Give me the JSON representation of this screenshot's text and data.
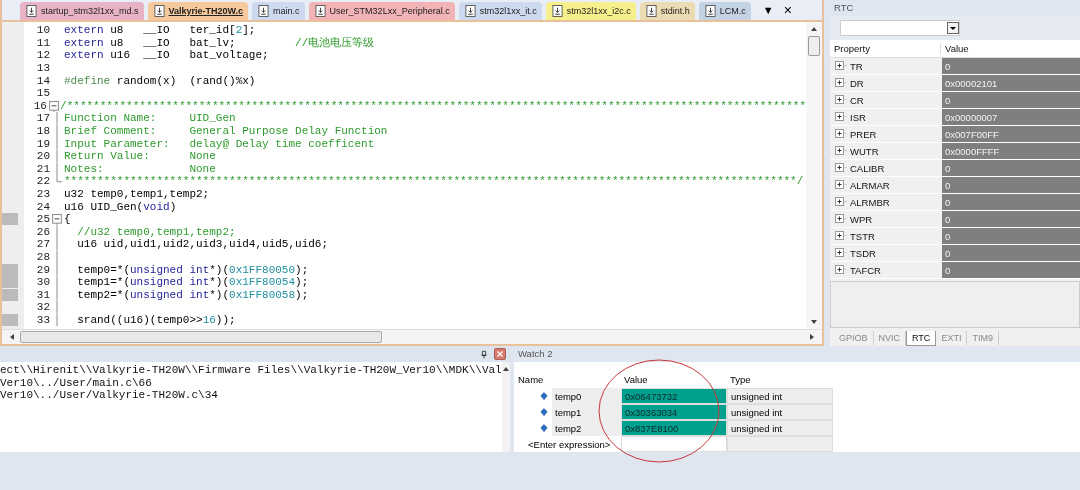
{
  "editor": {
    "tabs": [
      {
        "label": "startup_stm32l1xx_md.s",
        "selected": false,
        "color": "#e9b3c6"
      },
      {
        "label": "Valkyrie-TH20W.c",
        "selected": true,
        "color": "#f6c99c"
      },
      {
        "label": "main.c",
        "selected": false,
        "color": "#cdd9ef"
      },
      {
        "label": "User_STM32Lxx_Peripheral.c",
        "selected": false,
        "color": "#f2b3b6"
      },
      {
        "label": "stm32l1xx_it.c",
        "selected": false,
        "color": "#cdd9ef"
      },
      {
        "label": "stm32l1xx_i2c.c",
        "selected": false,
        "color": "#f5f08c"
      },
      {
        "label": "stdint.h",
        "selected": false,
        "color": "#ecdcb4"
      },
      {
        "label": "LCM.c",
        "selected": false,
        "color": "#c3d3e3"
      }
    ],
    "tab_menu": "▼",
    "tab_close": "×",
    "lines": [
      {
        "number": "10",
        "tokens": [
          {
            "kind": "keyword",
            "text": "extern"
          },
          {
            "kind": "plain",
            "text": " u8   __IO   ter_id["
          },
          {
            "kind": "number",
            "text": "2"
          },
          {
            "kind": "plain",
            "text": "];"
          }
        ]
      },
      {
        "number": "11",
        "tokens": [
          {
            "kind": "keyword",
            "text": "extern"
          },
          {
            "kind": "plain",
            "text": " u8   __IO   bat_lv;         "
          },
          {
            "kind": "comment",
            "text": "//电池电压等级"
          }
        ]
      },
      {
        "number": "12",
        "tokens": [
          {
            "kind": "keyword",
            "text": "extern"
          },
          {
            "kind": "plain",
            "text": " u16  __IO   bat_voltage;"
          }
        ]
      },
      {
        "number": "13"
      },
      {
        "number": "14",
        "tokens": [
          {
            "kind": "preprocessor",
            "text": "#define"
          },
          {
            "kind": "plain",
            "text": " random(x)  (rand()%x)"
          }
        ]
      },
      {
        "number": "15"
      },
      {
        "number": "16",
        "fold_start": true,
        "tokens": [
          {
            "kind": "comment",
            "text": "/****************************************************************************************************************"
          }
        ]
      },
      {
        "number": "17",
        "fold_line": true,
        "tokens": [
          {
            "kind": "comment",
            "text": "Function Name:     UID_Gen"
          }
        ]
      },
      {
        "number": "18",
        "fold_line": true,
        "tokens": [
          {
            "kind": "comment",
            "text": "Brief Comment:     General Purpose Delay Function"
          }
        ]
      },
      {
        "number": "19",
        "fold_line": true,
        "tokens": [
          {
            "kind": "comment",
            "text": "Input Parameter:   delay@ Delay time coefficent"
          }
        ]
      },
      {
        "number": "20",
        "fold_line": true,
        "tokens": [
          {
            "kind": "comment",
            "text": "Return Value:      None"
          }
        ]
      },
      {
        "number": "21",
        "fold_line": true,
        "tokens": [
          {
            "kind": "comment",
            "text": "Notes:             None"
          }
        ]
      },
      {
        "number": "22",
        "fold_end": true,
        "tokens": [
          {
            "kind": "comment",
            "text": "***************************************************************************************************************/"
          }
        ]
      },
      {
        "number": "23",
        "tokens": [
          {
            "kind": "plain",
            "text": "u32 temp0,temp1,temp2;"
          }
        ]
      },
      {
        "number": "24",
        "tokens": [
          {
            "kind": "plain",
            "text": "u16 UID_Gen("
          },
          {
            "kind": "keyword",
            "text": "void"
          },
          {
            "kind": "plain",
            "text": ")"
          }
        ]
      },
      {
        "number": "25",
        "marked": true,
        "fold_start": true,
        "tokens": [
          {
            "kind": "plain",
            "text": "{"
          }
        ]
      },
      {
        "number": "26",
        "fold_line": true,
        "tokens": [
          {
            "kind": "comment",
            "text": "  //u32 temp0,temp1,temp2;"
          }
        ]
      },
      {
        "number": "27",
        "fold_line": true,
        "tokens": [
          {
            "kind": "plain",
            "text": "  u16 uid,uid1,uid2,uid3,uid4,uid5,uid6;"
          }
        ]
      },
      {
        "number": "28",
        "fold_line": true
      },
      {
        "number": "29",
        "marked": true,
        "fold_line": true,
        "tokens": [
          {
            "kind": "plain",
            "text": "  temp0=*("
          },
          {
            "kind": "keyword",
            "text": "unsigned int"
          },
          {
            "kind": "plain",
            "text": "*)("
          },
          {
            "kind": "number",
            "text": "0x1FF80050"
          },
          {
            "kind": "plain",
            "text": ");"
          }
        ]
      },
      {
        "number": "30",
        "marked": true,
        "fold_line": true,
        "tokens": [
          {
            "kind": "plain",
            "text": "  temp1=*("
          },
          {
            "kind": "keyword",
            "text": "unsigned int"
          },
          {
            "kind": "plain",
            "text": "*)("
          },
          {
            "kind": "number",
            "text": "0x1FF80054"
          },
          {
            "kind": "plain",
            "text": ");"
          }
        ]
      },
      {
        "number": "31",
        "marked": true,
        "fold_line": true,
        "tokens": [
          {
            "kind": "plain",
            "text": "  temp2=*("
          },
          {
            "kind": "keyword",
            "text": "unsigned int"
          },
          {
            "kind": "plain",
            "text": "*)("
          },
          {
            "kind": "number",
            "text": "0x1FF80058"
          },
          {
            "kind": "plain",
            "text": ");"
          }
        ]
      },
      {
        "number": "32",
        "fold_line": true
      },
      {
        "number": "33",
        "marked": true,
        "fold_line": true,
        "tokens": [
          {
            "kind": "plain",
            "text": "  srand((u16)(temp0>>"
          },
          {
            "kind": "number",
            "text": "16"
          },
          {
            "kind": "plain",
            "text": "));"
          }
        ]
      }
    ]
  },
  "peripheral": {
    "title": "RTC",
    "columns": [
      "Property",
      "Value"
    ],
    "registers": [
      {
        "name": "TR",
        "value": "0"
      },
      {
        "name": "DR",
        "value": "0x00002101"
      },
      {
        "name": "CR",
        "value": "0"
      },
      {
        "name": "ISR",
        "value": "0x00000007"
      },
      {
        "name": "PRER",
        "value": "0x007F00FF"
      },
      {
        "name": "WUTR",
        "value": "0x0000FFFF"
      },
      {
        "name": "CALIBR",
        "value": "0"
      },
      {
        "name": "ALRMAR",
        "value": "0"
      },
      {
        "name": "ALRMBR",
        "value": "0"
      },
      {
        "name": "WPR",
        "value": "0"
      },
      {
        "name": "TSTR",
        "value": "0"
      },
      {
        "name": "TSDR",
        "value": "0"
      },
      {
        "name": "TAFCR",
        "value": "0"
      }
    ],
    "tabs": [
      {
        "label": "GPIOB",
        "selected": false
      },
      {
        "label": "NVIC",
        "selected": false
      },
      {
        "label": "RTC",
        "selected": true
      },
      {
        "label": "EXTI",
        "selected": false
      },
      {
        "label": "TIM9",
        "selected": false
      }
    ]
  },
  "output": {
    "lines": [
      "ect\\\\Hirenit\\\\Valkyrie-TH20W\\\\Firmware Files\\\\Valkyrie-TH20W_Ver10\\\\MDK\\\\Val",
      "Ver10\\../User/main.c\\66",
      "Ver10\\../User/Valkyrie-TH20W.c\\34"
    ]
  },
  "watch": {
    "title": "Watch 2",
    "columns": [
      "Name",
      "Value",
      "Type"
    ],
    "rows": [
      {
        "name": "temp0",
        "value": "0x06473732",
        "type": "unsigned int",
        "changed": true
      },
      {
        "name": "temp1",
        "value": "0x30363034",
        "type": "unsigned int",
        "changed": true
      },
      {
        "name": "temp2",
        "value": "0x837E8100",
        "type": "unsigned int",
        "changed": true
      }
    ],
    "enter_expression": "<Enter expression>"
  }
}
